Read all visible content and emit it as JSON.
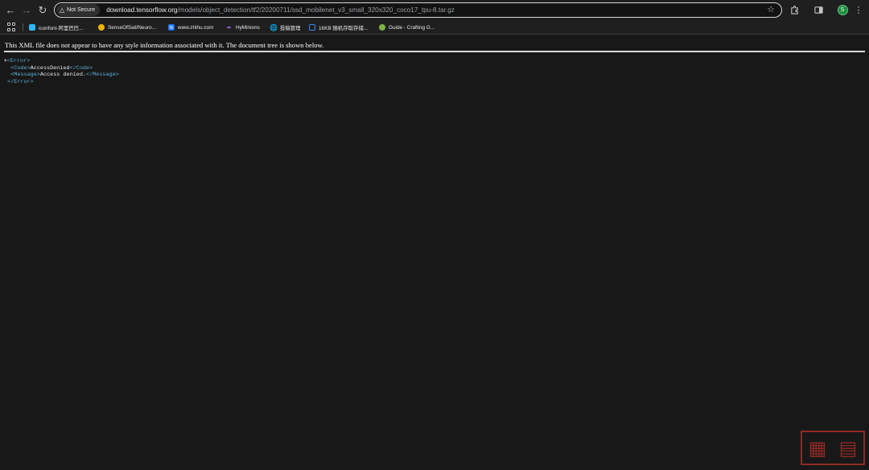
{
  "browser": {
    "security_chip": "Not Secure",
    "url_host": "download.tensorflow.org",
    "url_path": "/models/object_detection/tf2/20200711/ssd_mobilenet_v3_small_320x320_coco17_tpu-8.tar.gz",
    "profile_initial": "S",
    "icons": {
      "back": "arrow-left",
      "forward": "arrow-right",
      "reload": "reload",
      "warning": "warning-triangle",
      "star": "star",
      "extensions": "puzzle",
      "tab_search": "side-panel",
      "menu": "kebab"
    }
  },
  "bookmarks": [
    {
      "label": "iconfont-阿里巴巴...",
      "color": "#2db7f5"
    },
    {
      "label": "SenseOfSail/Neuro...",
      "color": "#f0b400"
    },
    {
      "label": "www.zhihu.com",
      "color": "#1772f6",
      "glyph": "知"
    },
    {
      "label": "HyMinions",
      "color": "#9c6cd8"
    },
    {
      "label": "投稿管理",
      "color": "#8a8a8a"
    },
    {
      "label": "16KB 随机存取存储...",
      "color": "#3b82f6"
    },
    {
      "label": "Guide - Crafting G...",
      "color": "#7cb342"
    }
  ],
  "page": {
    "notice": "This XML file does not appear to have any style information associated with it. The document tree is shown below.",
    "tree": {
      "toggle": "▼",
      "error_open": "<Error>",
      "code_open": "<Code>",
      "code_value": "AccessDenied",
      "code_close": "</Code>",
      "message_open": "<Message>",
      "message_value": "Access denied.",
      "message_close": "</Message>",
      "error_close": "</Error>"
    }
  },
  "watermark": {
    "color": "#8e2a24"
  }
}
